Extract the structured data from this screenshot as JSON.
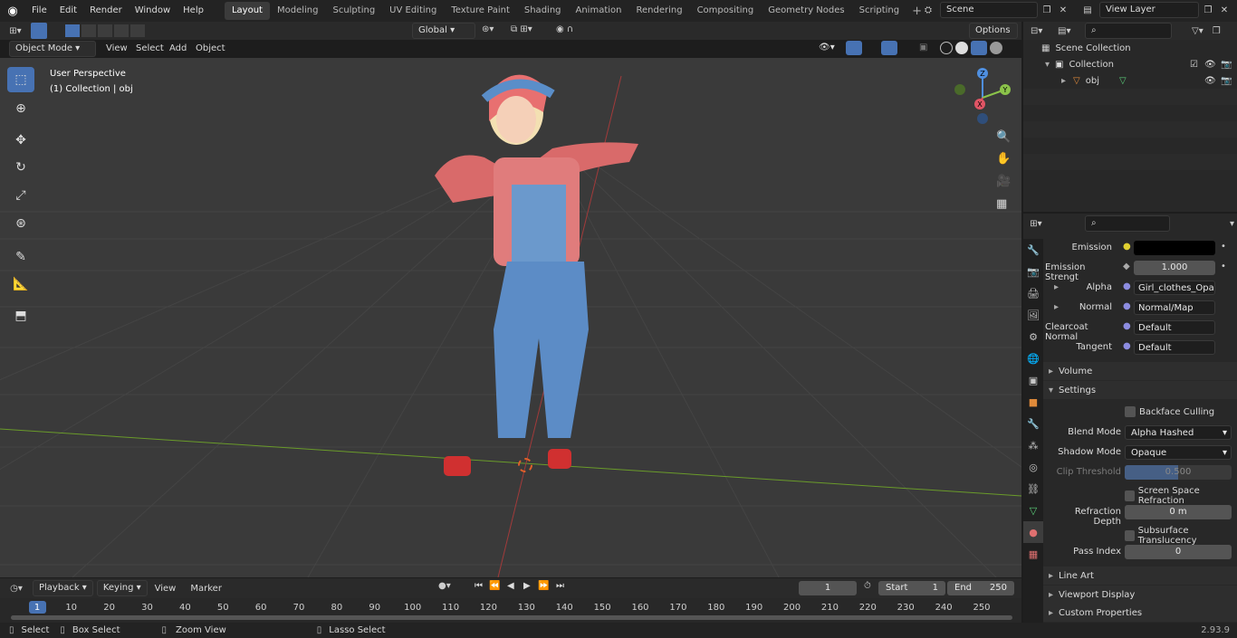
{
  "topbar": {
    "menu": [
      "File",
      "Edit",
      "Render",
      "Window",
      "Help"
    ],
    "workspaces": [
      "Layout",
      "Modeling",
      "Sculpting",
      "UV Editing",
      "Texture Paint",
      "Shading",
      "Animation",
      "Rendering",
      "Compositing",
      "Geometry Nodes",
      "Scripting"
    ],
    "active_workspace": "Layout",
    "scene": "Scene",
    "view_layer": "View Layer"
  },
  "viewport_header": {
    "mode": "Object Mode",
    "menus": [
      "View",
      "Select",
      "Add",
      "Object"
    ],
    "orientation": "Global",
    "options": "Options"
  },
  "viewport": {
    "perspective": "User Perspective",
    "collection_info": "(1) Collection | obj",
    "gizmo": {
      "z": "Z",
      "y": "Y",
      "x": "X"
    }
  },
  "outliner": {
    "items": [
      {
        "label": "Scene Collection"
      },
      {
        "label": "Collection"
      },
      {
        "label": "obj"
      }
    ]
  },
  "properties": {
    "rows": [
      {
        "label": "Emission",
        "value": ""
      },
      {
        "label": "Emission Strengt",
        "value": "1.000"
      },
      {
        "label": "Alpha",
        "value": "Girl_clothes_Opacity..."
      },
      {
        "label": "Normal",
        "value": "Normal/Map"
      },
      {
        "label": "Clearcoat Normal",
        "value": "Default"
      },
      {
        "label": "Tangent",
        "value": "Default"
      }
    ],
    "sections": {
      "volume": "Volume",
      "settings": "Settings",
      "line_art": "Line Art",
      "viewport_display": "Viewport Display",
      "custom_properties": "Custom Properties"
    },
    "settings": {
      "backface_culling": "Backface Culling",
      "blend_mode_label": "Blend Mode",
      "blend_mode": "Alpha Hashed",
      "shadow_mode_label": "Shadow Mode",
      "shadow_mode": "Opaque",
      "clip_threshold_label": "Clip Threshold",
      "clip_threshold": "0.500",
      "ssr": "Screen Space Refraction",
      "refraction_depth_label": "Refraction Depth",
      "refraction_depth": "0 m",
      "subsurface": "Subsurface Translucency",
      "pass_index_label": "Pass Index",
      "pass_index": "0"
    }
  },
  "timeline": {
    "menus": [
      "Playback",
      "Keying",
      "View",
      "Marker"
    ],
    "current_frame": "1",
    "start_label": "Start",
    "start": "1",
    "end_label": "End",
    "end": "250",
    "ticks": [
      "1",
      "10",
      "20",
      "30",
      "40",
      "50",
      "60",
      "70",
      "80",
      "90",
      "100",
      "110",
      "120",
      "130",
      "140",
      "150",
      "160",
      "170",
      "180",
      "190",
      "200",
      "210",
      "220",
      "230",
      "240",
      "250"
    ]
  },
  "statusbar": {
    "select": "Select",
    "box_select": "Box Select",
    "zoom_view": "Zoom View",
    "lasso_select": "Lasso Select",
    "version": "2.93.9"
  },
  "colors": {
    "accent": "#4772b3",
    "x_axis": "#a23a3a",
    "y_axis": "#6a9b2a",
    "gizmo_x": "#e05565",
    "gizmo_y": "#8bc34a",
    "gizmo_z": "#4f8fe0"
  }
}
